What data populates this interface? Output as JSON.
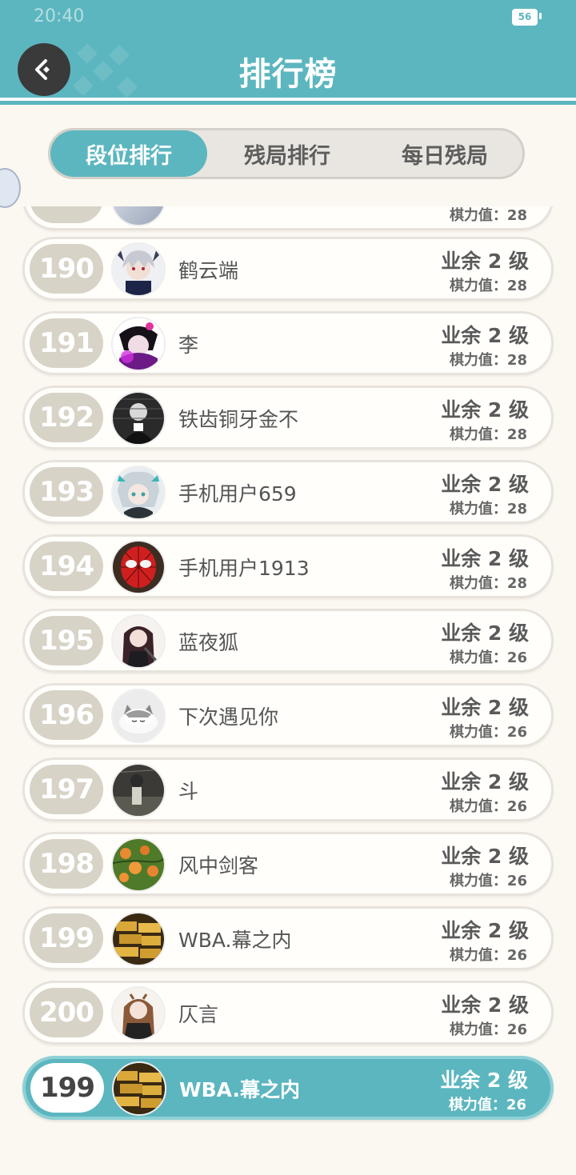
{
  "status_bar": {
    "time": "20:40",
    "battery": "56"
  },
  "header": {
    "title": "排行榜"
  },
  "tabs": [
    {
      "label": "段位排行",
      "active": true
    },
    {
      "label": "残局排行",
      "active": false
    },
    {
      "label": "每日残局",
      "active": false
    }
  ],
  "partial_row": {
    "power": "棋力值：28"
  },
  "rows": [
    {
      "rank": "190",
      "name": "鹤云端",
      "level": "业余 2 级",
      "power": "棋力值：28",
      "avatar": "avatar-anime-white-hair"
    },
    {
      "rank": "191",
      "name": "李",
      "level": "业余 2 级",
      "power": "棋力值：28",
      "avatar": "avatar-anime-purple"
    },
    {
      "rank": "192",
      "name": "铁齿铜牙金不",
      "level": "业余 2 级",
      "power": "棋力值：28",
      "avatar": "avatar-photo-bw"
    },
    {
      "rank": "193",
      "name": "手机用户659",
      "level": "业余 2 级",
      "power": "棋力值：28",
      "avatar": "avatar-anime-teal"
    },
    {
      "rank": "194",
      "name": "手机用户1913",
      "level": "业余 2 级",
      "power": "棋力值：28",
      "avatar": "avatar-spiderman"
    },
    {
      "rank": "195",
      "name": "蓝夜狐",
      "level": "业余 2 级",
      "power": "棋力值：26",
      "avatar": "avatar-anime-dark-hair"
    },
    {
      "rank": "196",
      "name": "下次遇见你",
      "level": "业余 2 级",
      "power": "棋力值：26",
      "avatar": "avatar-cat"
    },
    {
      "rank": "197",
      "name": "⽃",
      "level": "业余 2 级",
      "power": "棋力值：26",
      "avatar": "avatar-photo-dark"
    },
    {
      "rank": "198",
      "name": "风中剑客",
      "level": "业余 2 级",
      "power": "棋力值：26",
      "avatar": "avatar-oranges"
    },
    {
      "rank": "199",
      "name": "WBA.幕之内",
      "level": "业余 2 级",
      "power": "棋力值：26",
      "avatar": "avatar-gold"
    },
    {
      "rank": "200",
      "name": "仄言",
      "level": "业余 2 级",
      "power": "棋力值：26",
      "avatar": "avatar-anime-brown-hair"
    }
  ],
  "my_rank": {
    "rank": "199",
    "name": "WBA.幕之内",
    "level": "业余 2 级",
    "power": "棋力值：26",
    "avatar": "avatar-gold"
  },
  "colors": {
    "accent": "#5cb6bf",
    "rank_badge": "#d8d3c7",
    "background": "#fbf8f1"
  }
}
